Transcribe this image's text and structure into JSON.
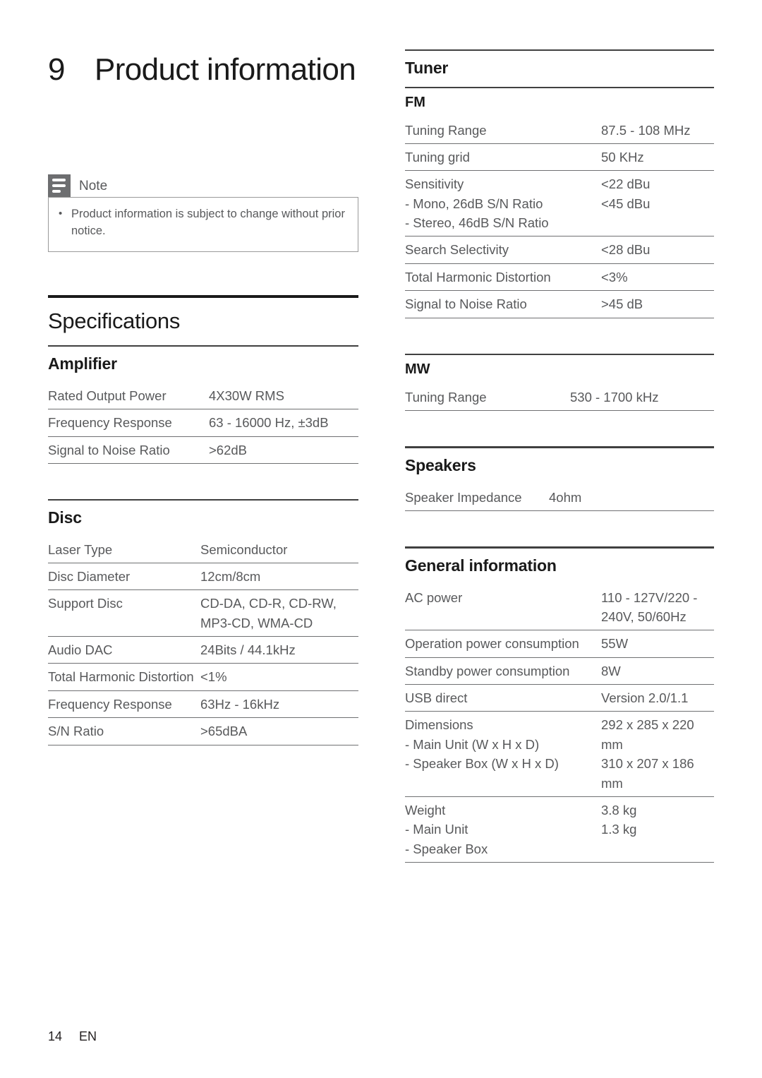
{
  "chapter": {
    "number": "9",
    "title": "Product information"
  },
  "note": {
    "icon": "note-lines-icon",
    "label": "Note",
    "items": [
      "Product information is subject to change without prior notice."
    ]
  },
  "specifications": {
    "heading": "Specifications",
    "sections": [
      {
        "id": "amplifier",
        "heading": "Amplifier",
        "rows": [
          {
            "label": "Rated Output Power",
            "value": "4X30W RMS"
          },
          {
            "label": "Frequency Response",
            "value": "63 - 16000 Hz, ±3dB"
          },
          {
            "label": "Signal to Noise Ratio",
            "value": ">62dB"
          }
        ]
      },
      {
        "id": "disc",
        "heading": "Disc",
        "rows": [
          {
            "label": "Laser Type",
            "value": "Semiconductor"
          },
          {
            "label": "Disc Diameter",
            "value": "12cm/8cm"
          },
          {
            "label": "Support Disc",
            "value": "CD-DA, CD-R, CD-RW, MP3-CD, WMA-CD"
          },
          {
            "label": "Audio DAC",
            "value": "24Bits / 44.1kHz"
          },
          {
            "label": "Total Harmonic Distortion",
            "value": "<1%"
          },
          {
            "label": "Frequency Response",
            "value": "63Hz - 16kHz"
          },
          {
            "label": "S/N Ratio",
            "value": ">65dBA"
          }
        ]
      }
    ]
  },
  "tuner": {
    "heading": "Tuner",
    "fm": {
      "heading": "FM",
      "rows": [
        {
          "label": "Tuning Range",
          "value": "87.5 - 108 MHz"
        },
        {
          "label": "Tuning grid",
          "value": "50 KHz"
        },
        {
          "label": "Sensitivity",
          "sublabels": [
            "- Mono, 26dB S/N Ratio",
            "- Stereo, 46dB S/N Ratio"
          ],
          "value": "<22 dBu",
          "subvalues": [
            "<45 dBu"
          ]
        },
        {
          "label": "Search Selectivity",
          "value": "<28 dBu"
        },
        {
          "label": "Total Harmonic Distortion",
          "value": "<3%"
        },
        {
          "label": "Signal to Noise Ratio",
          "value": ">45 dB"
        }
      ]
    },
    "mw": {
      "heading": "MW",
      "rows": [
        {
          "label": "Tuning Range",
          "value": "530 - 1700 kHz"
        }
      ]
    }
  },
  "speakers": {
    "heading": "Speakers",
    "rows": [
      {
        "label": "Speaker Impedance",
        "value": "4ohm"
      }
    ]
  },
  "general": {
    "heading": "General information",
    "rows": [
      {
        "label": "AC power",
        "value": "110 - 127V/220 - 240V, 50/60Hz"
      },
      {
        "label": "Operation power consumption",
        "value": "55W"
      },
      {
        "label": "Standby power consumption",
        "value": "8W"
      },
      {
        "label": "USB direct",
        "value": "Version 2.0/1.1"
      },
      {
        "label": "Dimensions",
        "sublabels": [
          "- Main Unit (W x H x D)",
          "- Speaker Box (W x H x D)"
        ],
        "value": "292 x 285 x 220 mm",
        "subvalues": [
          "310 x 207 x 186 mm"
        ]
      },
      {
        "label": "Weight",
        "sublabels": [
          "- Main Unit",
          "- Speaker Box"
        ],
        "value": "3.8 kg",
        "subvalues": [
          "1.3 kg"
        ]
      }
    ]
  },
  "footer": {
    "page": "14",
    "language": "EN"
  }
}
